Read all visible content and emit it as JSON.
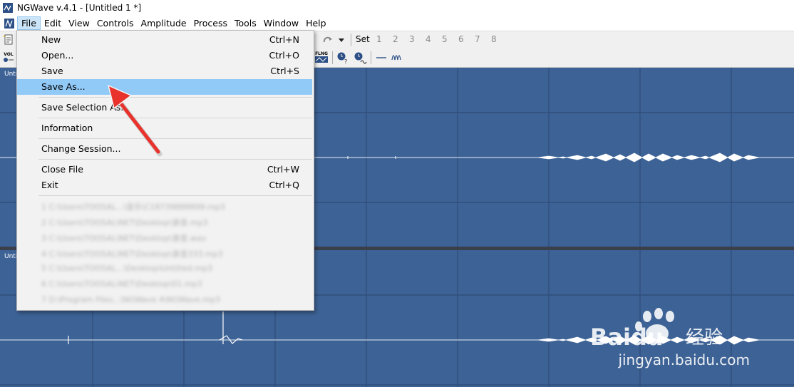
{
  "window": {
    "title": "NGWave v.4.1 - [Untitled 1 *]"
  },
  "menubar": {
    "items": [
      {
        "label": "File",
        "active": true
      },
      {
        "label": "Edit"
      },
      {
        "label": "View"
      },
      {
        "label": "Controls"
      },
      {
        "label": "Amplitude"
      },
      {
        "label": "Process"
      },
      {
        "label": "Tools"
      },
      {
        "label": "Window"
      },
      {
        "label": "Help"
      }
    ]
  },
  "toolbar": {
    "set_label": "Set",
    "presets": [
      "1",
      "2",
      "3",
      "4",
      "5",
      "6",
      "7",
      "8"
    ],
    "vol_label": "VOL",
    "flng_label": "FLNG"
  },
  "file_menu": {
    "items": [
      {
        "label": "New",
        "shortcut": "Ctrl+N"
      },
      {
        "label": "Open...",
        "shortcut": "Ctrl+O"
      },
      {
        "label": "Save",
        "shortcut": "Ctrl+S"
      },
      {
        "label": "Save As...",
        "shortcut": "",
        "highlighted": true
      },
      {
        "label": "Save Selection As...",
        "shortcut": ""
      },
      {
        "label": "Information",
        "shortcut": ""
      },
      {
        "label": "Change Session...",
        "shortcut": ""
      },
      {
        "label": "Close File",
        "shortcut": "Ctrl+W"
      },
      {
        "label": "Exit",
        "shortcut": "Ctrl+Q"
      }
    ],
    "recent_files": [
      "1 C:\\Users\\TOOSAL...\\音乐\\C18739888899.mp3",
      "2 C:\\Users\\TOOSAL\\NET\\Desktop\\录音.mp3",
      "3 C:\\Users\\TOOSAL\\NET\\Desktop\\录音.wav",
      "4 C:\\Users\\TOOSAL\\NET\\Desktop\\录音333.mp3",
      "5 C:\\Users\\TOOSAL...\\Desktop\\Untitled.mp3",
      "6 C:\\Users\\TOOSAL\\NET\\Desktop\\01.mp3",
      "7 D:\\Program Files...\\NGWave 4\\NGWave.mp3"
    ]
  },
  "tracks": [
    {
      "label": "Unti"
    },
    {
      "label": "Unti"
    }
  ],
  "watermark": {
    "brand": "Baidu",
    "cn": "经验",
    "url": "jingyan.baidu.com"
  },
  "colors": {
    "waveform_bg": "#3d6295",
    "highlight": "#91c9f7",
    "arrow": "#e8322b"
  }
}
